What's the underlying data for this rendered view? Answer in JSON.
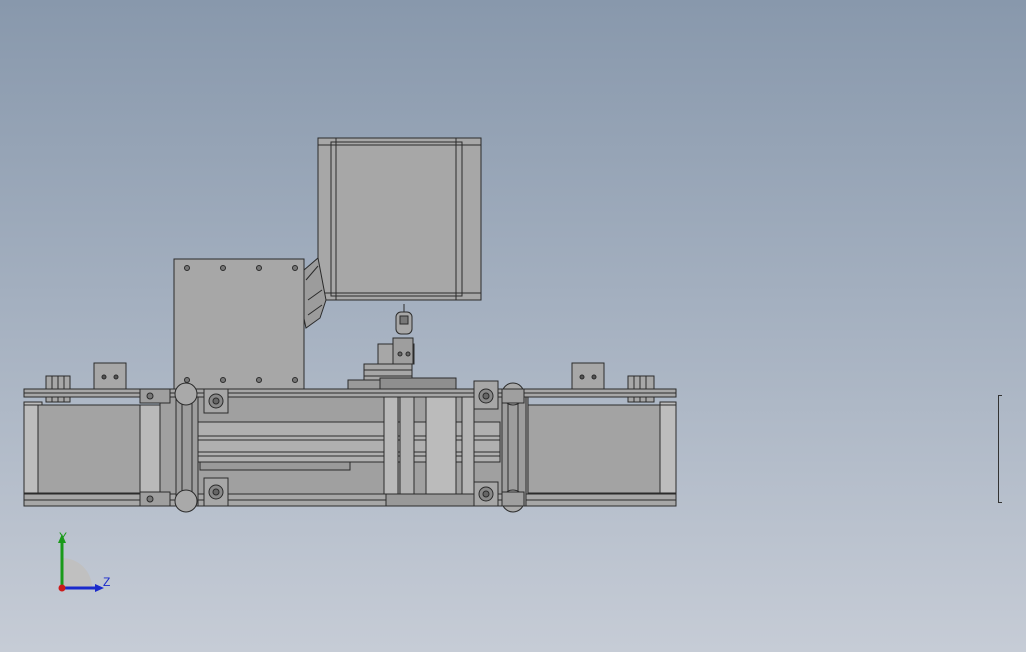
{
  "viewport": {
    "background_top": "#8898ac",
    "background_bottom": "#c6ccd6"
  },
  "colors": {
    "part_fill": "#a7a7a7",
    "part_fill_dark": "#959595",
    "part_fill_light": "#bdbdbd",
    "edge": "#2b2b2b",
    "y_axis": "#1a9a1a",
    "z_axis": "#1a2acc",
    "x_axis": "#cc1a1a"
  },
  "triad": {
    "y_label": "Y",
    "z_label": "Z"
  },
  "icons": {
    "triad": "coordinate-triad-icon"
  }
}
